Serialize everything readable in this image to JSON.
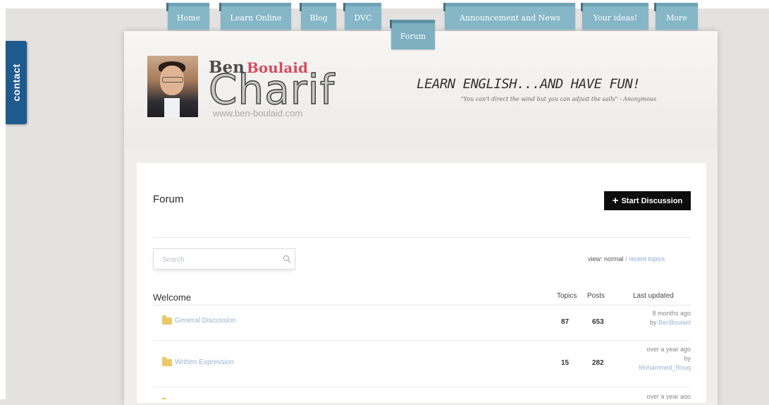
{
  "contact_tab": {
    "label": "contact"
  },
  "nav": {
    "tabs": [
      {
        "label": "Home"
      },
      {
        "label": "Learn Online"
      },
      {
        "label": "Blog"
      },
      {
        "label": "DVC"
      },
      {
        "label": "Forum",
        "active": true
      },
      {
        "label": "Announcement and News"
      },
      {
        "label": "Your ideas!"
      },
      {
        "label": "More"
      }
    ]
  },
  "logo": {
    "first": "Ben",
    "second": "Boulaid",
    "main": "Charif",
    "url": "www.ben-boulaid.com"
  },
  "header": {
    "tagline": "LEARN ENGLISH...AND HAVE FUN!",
    "quote": "\"You can't direct the wind but you can adjust the sails\" - Anonymous"
  },
  "forum": {
    "title": "Forum",
    "start_button": {
      "icon": "plus-icon",
      "label": "Start Discussion"
    },
    "search": {
      "placeholder": "Search",
      "icon": "search-icon"
    },
    "view": {
      "prefix": "view:",
      "normal": "normal",
      "separator": "/",
      "recent": "recent topics"
    },
    "table": {
      "section": "Welcome",
      "columns": {
        "topics": "Topics",
        "posts": "Posts",
        "updated": "Last updated"
      },
      "rows": [
        {
          "name": "General Discussion",
          "topics": "87",
          "posts": "653",
          "updated": "8 months ago",
          "by": "by",
          "user": "BenBoulaid"
        },
        {
          "name": "Written Expression",
          "topics": "15",
          "posts": "282",
          "updated": "over a year ago",
          "by": "by",
          "user": "Mohammed_Rouq"
        },
        {
          "name": "",
          "topics": "",
          "posts": "",
          "updated": "over a year ago",
          "by": "",
          "user": ""
        }
      ]
    }
  },
  "colors": {
    "contact_tab": "#1f5a8e",
    "nav_tab": "#86b7c8",
    "button": "#0d0d0d",
    "accent_red": "#d94a5e",
    "link": "#9ab4d2"
  }
}
